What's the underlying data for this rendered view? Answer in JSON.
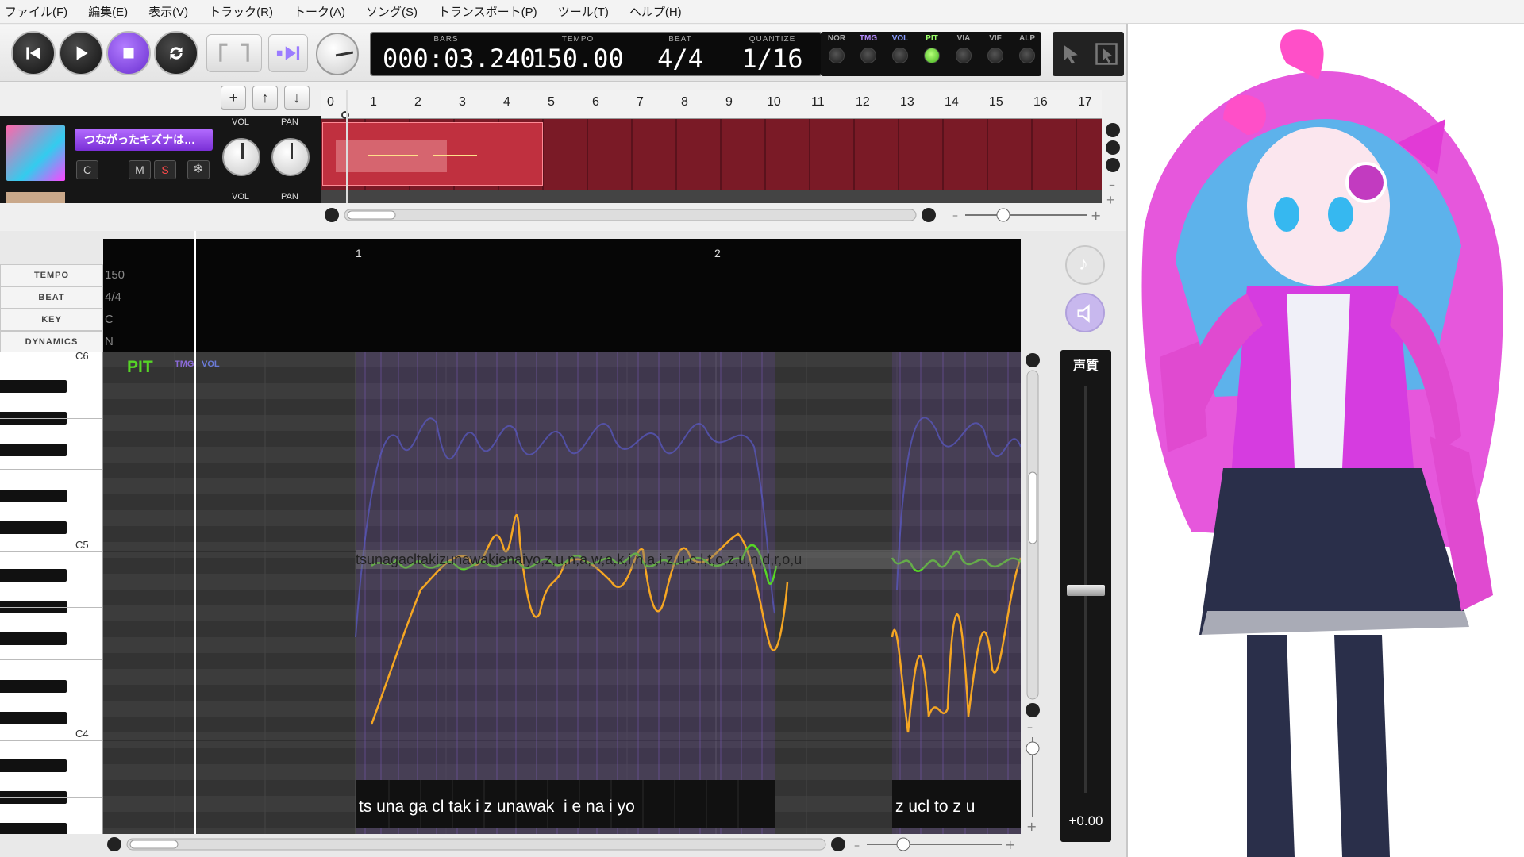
{
  "menu": [
    "ファイル(F)",
    "編集(E)",
    "表示(V)",
    "トラック(R)",
    "トーク(A)",
    "ソング(S)",
    "トランスポート(P)",
    "ツール(T)",
    "ヘルプ(H)"
  ],
  "lcd": {
    "bars_label": "BARS",
    "bars": "000:03.240",
    "tempo_label": "TEMPO",
    "tempo": "150.00",
    "beat_label": "BEAT",
    "beat": "4/4",
    "quantize_label": "QUANTIZE",
    "quantize": "1/16"
  },
  "modes": [
    {
      "label": "NOR",
      "on": false,
      "color": "#aaaaaa"
    },
    {
      "label": "TMG",
      "on": false,
      "color": "#b68cff"
    },
    {
      "label": "VOL",
      "on": false,
      "color": "#8a9cff"
    },
    {
      "label": "PIT",
      "on": true,
      "color": "#9cff6a"
    },
    {
      "label": "VIA",
      "on": false,
      "color": "#999999"
    },
    {
      "label": "VIF",
      "on": false,
      "color": "#999999"
    },
    {
      "label": "ALP",
      "on": false,
      "color": "#999999"
    }
  ],
  "track": {
    "name": "つながったキズナは…",
    "c_label": "C",
    "m_label": "M",
    "s_label": "S",
    "vol_label": "VOL",
    "pan_label": "PAN"
  },
  "ruler": [
    "0",
    "1",
    "2",
    "3",
    "4",
    "5",
    "6",
    "7",
    "8",
    "9",
    "10",
    "11",
    "12",
    "13",
    "14",
    "15",
    "16",
    "17"
  ],
  "editor": {
    "bar_marks": [
      "1",
      "2"
    ],
    "rows": [
      {
        "label": "TEMPO",
        "value": "150"
      },
      {
        "label": "BEAT",
        "value": "4/4"
      },
      {
        "label": "KEY",
        "value": "C"
      },
      {
        "label": "DYNAMICS",
        "value": "N"
      }
    ],
    "octaves": [
      "C6",
      "C5",
      "C4"
    ],
    "mode_big": "PIT",
    "mode_tmg": "TMG",
    "mode_vol": "VOL",
    "phonemes_left": "ts una ga cl tak i z unawak  i e na i yo",
    "phonemes_right": "z ucl to z u",
    "lyric_row": "tsunagacltakizunawakienaiyo,z,u,n,a,w,a,k,i,n,a,i,z,u,c,l,t,o,z,u,n,d,r,o,u",
    "quality_label": "声質",
    "quality_value": "+0.00"
  },
  "colors": {
    "accent": "#7a2fd6",
    "pitch_line": "#56d626",
    "orig_pitch": "#f5a623",
    "track_lane": "#7a1a26",
    "region": "#c0303f"
  }
}
